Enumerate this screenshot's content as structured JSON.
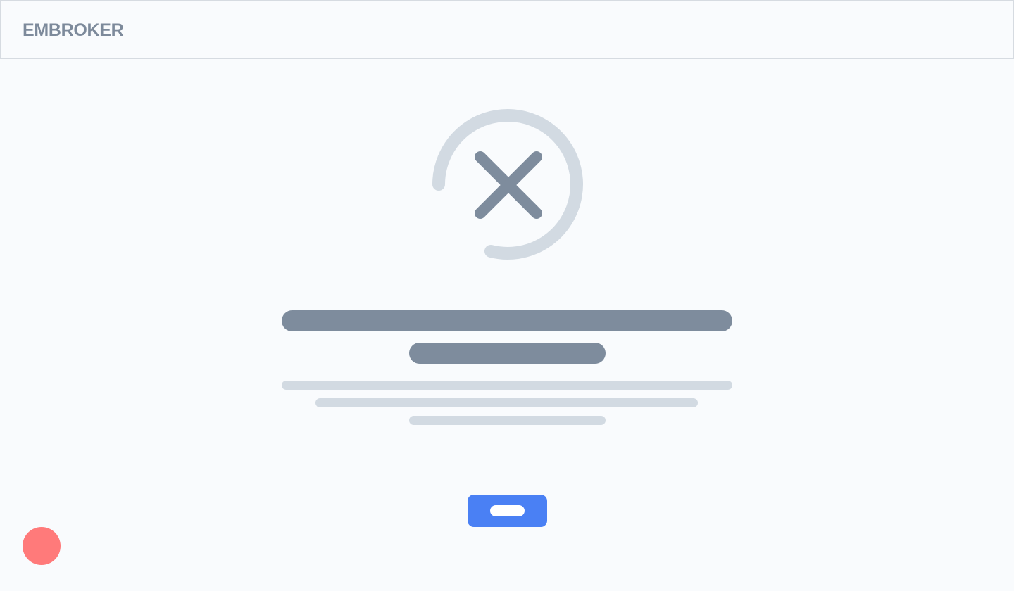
{
  "header": {
    "logo_text": "EMBROKER"
  },
  "status": {
    "icon": "close-icon",
    "state": "error"
  },
  "colors": {
    "background": "#f9fbfd",
    "header_border": "#d6dbe1",
    "logo": "#7d8a9b",
    "ring": "#d2dae2",
    "x_mark": "#7e8c9d",
    "skeleton_dark": "#7e8c9d",
    "skeleton_light": "#d2dae2",
    "primary_button": "#4a80f4",
    "chat_launcher": "#ff7a7a"
  }
}
